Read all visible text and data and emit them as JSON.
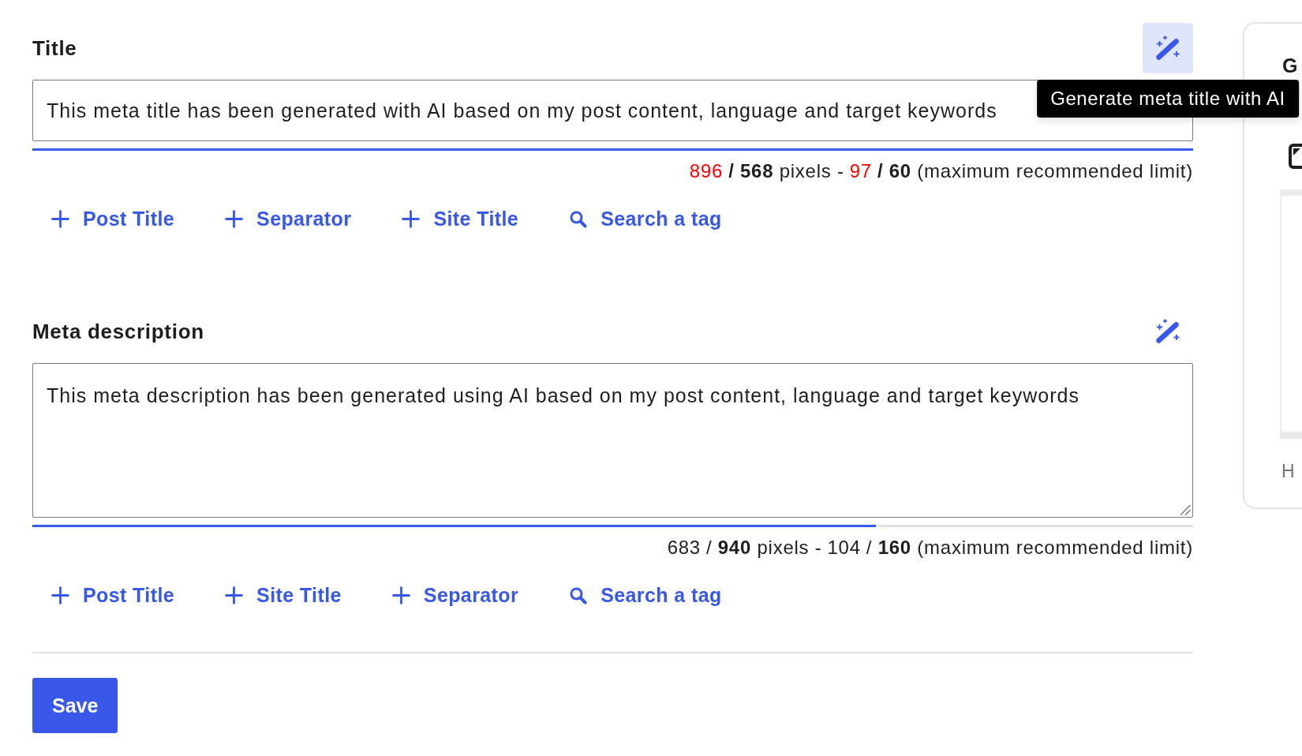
{
  "fields": [
    {
      "kind": "input",
      "label": "Title",
      "ai_button": {
        "hovered": true,
        "tooltip": "Generate meta title with AI"
      },
      "value": "This meta title has been generated with AI based on my post content, language and target keywords",
      "meter": {
        "level": 1
      },
      "counter": {
        "pixels": {
          "count": "896",
          "over_limit": true,
          "rest": "**/ 568** pixels -"
        },
        "characters": {
          "count": "97",
          "over_limit": true,
          "rest": "**/ 60** (maximum recommended limit)"
        }
      },
      "tags": [
        {
          "kind": "add",
          "label": "Post Title"
        },
        {
          "kind": "add",
          "label": "Separator"
        },
        {
          "kind": "add",
          "label": "Site Title"
        },
        {
          "kind": "search",
          "label": "Search a tag"
        }
      ]
    },
    {
      "kind": "textarea",
      "label": "Meta description",
      "ai_button": {
        "hovered": false
      },
      "value": "This meta description has been generated using AI based on my post content, language and target keywords",
      "meter": {
        "level": 0.727
      },
      "counter": {
        "pixels": {
          "count": "683",
          "over_limit": false,
          "rest": "/ **940** pixels -"
        },
        "characters": {
          "count": "104",
          "over_limit": false,
          "rest": "/ **160** (maximum recommended limit)"
        }
      },
      "tags": [
        {
          "kind": "add",
          "label": "Post Title"
        },
        {
          "kind": "add",
          "label": "Site Title"
        },
        {
          "kind": "add",
          "label": "Separator"
        },
        {
          "kind": "search",
          "label": "Search a tag"
        }
      ]
    }
  ],
  "save_button": {
    "label": "Save"
  },
  "side_panel": {
    "heading": "G",
    "note": "H"
  }
}
